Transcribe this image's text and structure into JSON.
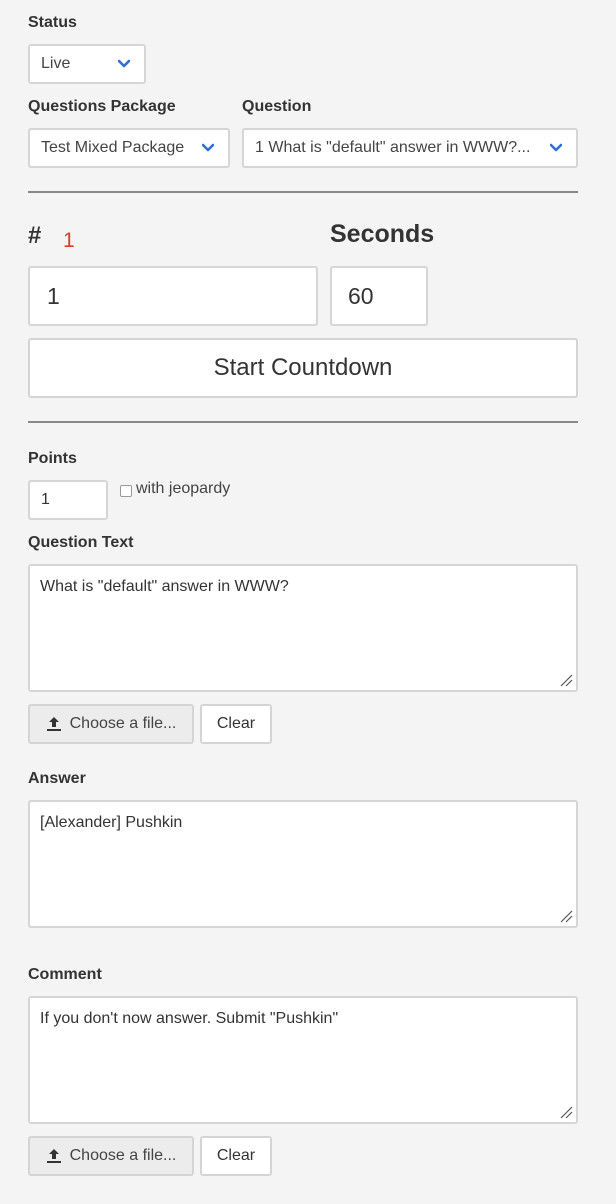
{
  "status": {
    "label": "Status",
    "value": "Live"
  },
  "package": {
    "label": "Questions Package",
    "value": "Test Mixed Package"
  },
  "question": {
    "label": "Question",
    "value": "1 What is \"default\" answer in WWW?..."
  },
  "countdown": {
    "number_label": "#",
    "number_indicator": "1",
    "seconds_label": "Seconds",
    "number_value": "1",
    "seconds_value": "60",
    "start_label": "Start Countdown"
  },
  "points": {
    "label": "Points",
    "value": "1",
    "jeopardy_label": "with jeopardy",
    "jeopardy_checked": false
  },
  "question_text": {
    "label": "Question Text",
    "value": "What is \"default\" answer in WWW?"
  },
  "file1": {
    "choose_label": "Choose a file...",
    "clear_label": "Clear"
  },
  "answer": {
    "label": "Answer",
    "value": "[Alexander] Pushkin"
  },
  "comment": {
    "label": "Comment",
    "value": "If you don't now answer. Submit \"Pushkin\""
  },
  "file2": {
    "choose_label": "Choose a file...",
    "clear_label": "Clear"
  },
  "colors": {
    "accent": "#2f6fd6",
    "indicator": "#e0392b",
    "divider": "#888888"
  },
  "icons": {
    "dropdown": "chevron-down-icon",
    "upload": "upload-icon",
    "resize": "resize-grip-icon"
  }
}
